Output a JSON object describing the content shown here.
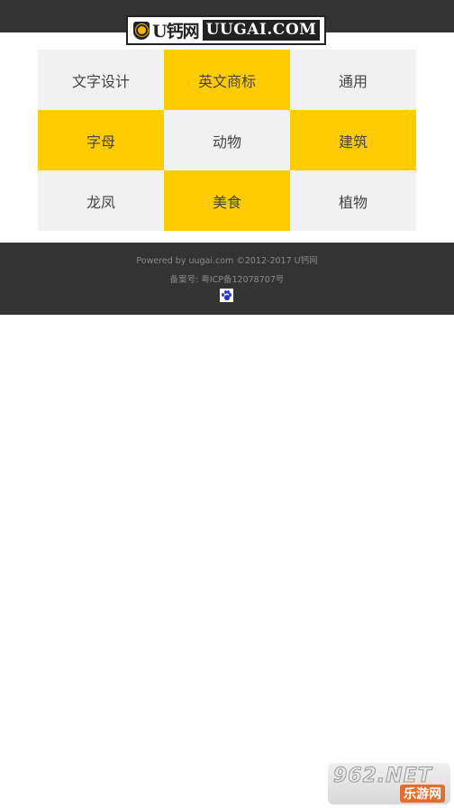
{
  "header": {
    "logo_cn": "U钙网",
    "logo_en": "UUGAI.COM"
  },
  "categories": [
    {
      "label": "文字设计",
      "style": "grey"
    },
    {
      "label": "英文商标",
      "style": "yellow"
    },
    {
      "label": "通用",
      "style": "grey"
    },
    {
      "label": "字母",
      "style": "yellow"
    },
    {
      "label": "动物",
      "style": "grey"
    },
    {
      "label": "建筑",
      "style": "yellow"
    },
    {
      "label": "龙凤",
      "style": "grey"
    },
    {
      "label": "美食",
      "style": "yellow"
    },
    {
      "label": "植物",
      "style": "grey"
    }
  ],
  "footer": {
    "powered": "Powered by uugai.com ©2012-2017 U钙网",
    "icp": "备案号: 粤ICP备12078707号",
    "stat_icon": "baidu-paw-icon"
  },
  "watermark": {
    "top": "962.NET",
    "bottom": "乐游网"
  },
  "colors": {
    "header_bg": "#333333",
    "accent_yellow": "#ffcc00",
    "cell_grey": "#f1f1f1"
  }
}
